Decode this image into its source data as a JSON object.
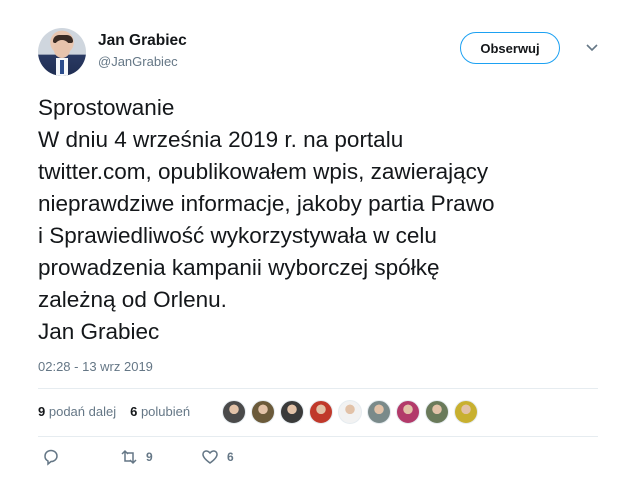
{
  "author": {
    "name": "Jan Grabiec",
    "handle": "@JanGrabiec",
    "follow_label": "Obserwuj"
  },
  "tweet": {
    "lines": [
      "Sprostowanie",
      "W dniu 4 września 2019 r. na portalu",
      "twitter.com, opublikowałem wpis, zawierający",
      "nieprawdziwe informacje, jakoby partia Prawo",
      "i Sprawiedliwość wykorzystywała w celu",
      "prowadzenia kampanii wyborczej spółkę",
      "zależną od Orlenu.",
      "Jan Grabiec"
    ],
    "timestamp": "02:28 - 13 wrz 2019"
  },
  "stats": {
    "retweets_count": "9",
    "retweets_label": "podań dalej",
    "likes_count": "6",
    "likes_label": "polubień"
  },
  "likers": [
    {
      "icon": "liker-avatar-1",
      "color": "#4a4a4a"
    },
    {
      "icon": "liker-avatar-2",
      "color": "#6b5a3a"
    },
    {
      "icon": "liker-avatar-3",
      "color": "#3a3a3a"
    },
    {
      "icon": "liker-avatar-4",
      "color": "#c0392b"
    },
    {
      "icon": "liker-avatar-5",
      "color": "#f2f2f2"
    },
    {
      "icon": "liker-avatar-6",
      "color": "#7a8a8a"
    },
    {
      "icon": "liker-avatar-7",
      "color": "#b23a6a"
    },
    {
      "icon": "liker-avatar-8",
      "color": "#6a7a5a"
    },
    {
      "icon": "liker-avatar-9",
      "color": "#c8b030"
    }
  ],
  "actions": {
    "reply_icon": "reply-icon",
    "retweet_icon": "retweet-icon",
    "retweet_count": "9",
    "like_icon": "heart-icon",
    "like_count": "6"
  },
  "colors": {
    "accent": "#1da1f2",
    "secondary_text": "#657786",
    "divider": "#e6ecf0"
  }
}
